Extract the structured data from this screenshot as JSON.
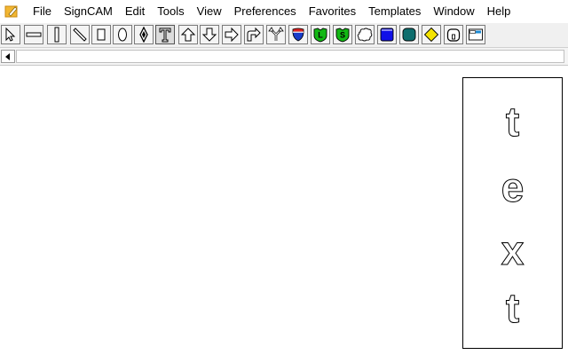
{
  "window": {
    "app_icon": "app-pencil-icon"
  },
  "menu": [
    "File",
    "SignCAM",
    "Edit",
    "Tools",
    "View",
    "Preferences",
    "Favorites",
    "Templates",
    "Window",
    "Help"
  ],
  "toolbar": {
    "buttons": [
      {
        "name": "select-arrow-icon",
        "pressed": false
      },
      {
        "name": "horizontal-bar-icon",
        "pressed": false
      },
      {
        "name": "vertical-bar-icon",
        "pressed": false
      },
      {
        "name": "diagonal-bar-icon",
        "pressed": false
      },
      {
        "name": "rectangle-icon",
        "pressed": false
      },
      {
        "name": "oval-icon",
        "pressed": false
      },
      {
        "name": "diamond-outline-icon",
        "pressed": false
      },
      {
        "name": "text-tool-icon",
        "pressed": true
      },
      {
        "name": "arrow-up-icon",
        "pressed": false
      },
      {
        "name": "arrow-down-icon",
        "pressed": false
      },
      {
        "name": "arrow-right-icon",
        "pressed": false
      },
      {
        "name": "arrow-turn-icon",
        "pressed": false
      },
      {
        "name": "arrow-split-icon",
        "pressed": false
      },
      {
        "name": "interstate-shield-icon",
        "pressed": false
      },
      {
        "name": "shield-l-icon",
        "pressed": false
      },
      {
        "name": "shield-s-icon",
        "pressed": false
      },
      {
        "name": "cloud-shape-icon",
        "pressed": false
      },
      {
        "name": "blue-panel-icon",
        "pressed": false
      },
      {
        "name": "teal-rounded-square-icon",
        "pressed": false
      },
      {
        "name": "yellow-diamond-icon",
        "pressed": false
      },
      {
        "name": "rounded-marker-icon",
        "pressed": false
      },
      {
        "name": "panel-tab-icon",
        "pressed": false
      }
    ]
  },
  "ruler": {
    "scroll_icon": "scroll-left-icon"
  },
  "canvas": {
    "sign_letters": [
      "t",
      "e",
      "x",
      "t"
    ]
  }
}
